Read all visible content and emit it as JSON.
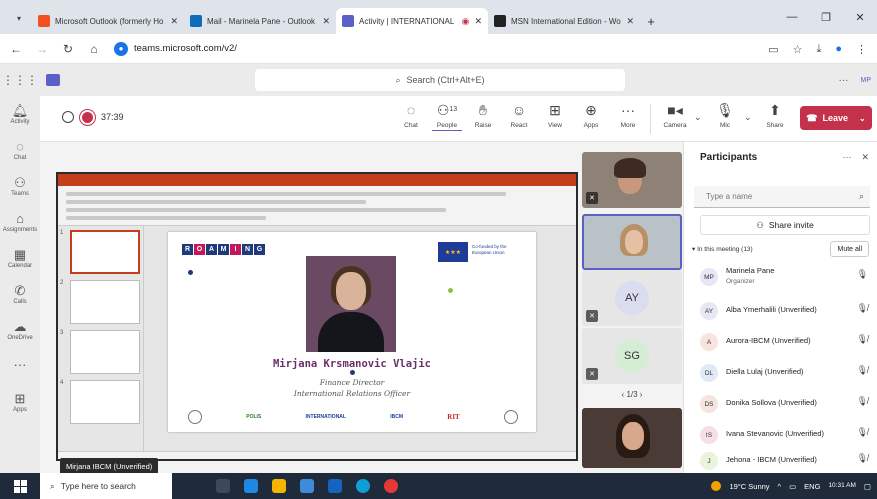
{
  "browser": {
    "tabs": [
      {
        "title": "Microsoft Outlook (formerly Ho",
        "favicon_color": "#f25022",
        "active": false
      },
      {
        "title": "Mail - Marinela Pane - Outlook",
        "favicon_color": "#0f6cbd",
        "active": false
      },
      {
        "title": "Activity | INTERNATIONAL",
        "favicon_color": "#5b5fc7",
        "active": true
      },
      {
        "title": "MSN International Edition - Wo",
        "favicon_color": "#222222",
        "active": false
      }
    ],
    "url": "teams.microsoft.com/v2/"
  },
  "teams": {
    "search_placeholder": "Search (Ctrl+Alt+E)",
    "rail": [
      {
        "label": "Activity",
        "icon": "bell-icon"
      },
      {
        "label": "Chat",
        "icon": "chat-icon"
      },
      {
        "label": "Teams",
        "icon": "teams-icon"
      },
      {
        "label": "Assignments",
        "icon": "assignments-icon"
      },
      {
        "label": "Calendar",
        "icon": "calendar-icon"
      },
      {
        "label": "Calls",
        "icon": "phone-icon"
      },
      {
        "label": "OneDrive",
        "icon": "cloud-icon"
      },
      {
        "label": "",
        "icon": "more-icon"
      },
      {
        "label": "Apps",
        "icon": "apps-icon"
      }
    ]
  },
  "meeting": {
    "timer": "37:39",
    "controls": {
      "chat": "Chat",
      "people": "People",
      "people_count": "13",
      "raise": "Raise",
      "react": "React",
      "view": "View",
      "apps": "Apps",
      "more": "More",
      "camera": "Camera",
      "mic": "Mic",
      "share": "Share",
      "leave": "Leave"
    },
    "presenter_tag": "Mirjana IBCM (Unverified)",
    "tile_initials": [
      "AY",
      "SG"
    ],
    "pager": "1/3"
  },
  "slide": {
    "brand_letters": [
      "R",
      "O",
      "A",
      "M",
      "I",
      "N",
      "G"
    ],
    "eu_caption": "Co-funded by the European Union",
    "name": "Mirjana Krsmanovic Vlajic",
    "role1": "Finance Director",
    "role2": "International Relations Officer",
    "logos": [
      "POLIS",
      "INTERNATIONAL",
      "IBCM",
      "RIT"
    ]
  },
  "participants": {
    "title": "Participants",
    "input_placeholder": "Type a name",
    "share_invite": "Share invite",
    "in_meeting": "In this meeting (13)",
    "mute_all": "Mute all",
    "list": [
      {
        "initials": "MP",
        "name": "Marinela Pane",
        "role": "Organizer",
        "color": "#e8e6f6"
      },
      {
        "initials": "AY",
        "name": "Alba Ymerhalili (Unverified)",
        "role": "",
        "color": "#e6e8f4"
      },
      {
        "initials": "A",
        "name": "Aurora-IBCM (Unverified)",
        "role": "",
        "color": "#f8e3de"
      },
      {
        "initials": "DL",
        "name": "Diella Lulaj (Unverified)",
        "role": "",
        "color": "#e0e9f6"
      },
      {
        "initials": "DS",
        "name": "Donika Sollova (Unverified)",
        "role": "",
        "color": "#f6e4de"
      },
      {
        "initials": "IS",
        "name": "Ivana Stevanovic (Unverified)",
        "role": "",
        "color": "#f6e0e8"
      },
      {
        "initials": "J",
        "name": "Jehona - IBCM (Unverified)",
        "role": "",
        "color": "#eaf3dc"
      }
    ]
  },
  "taskbar": {
    "search": "Type here to search",
    "weather": "19°C  Sunny",
    "lang": "ENG",
    "time": "10:31 AM"
  }
}
